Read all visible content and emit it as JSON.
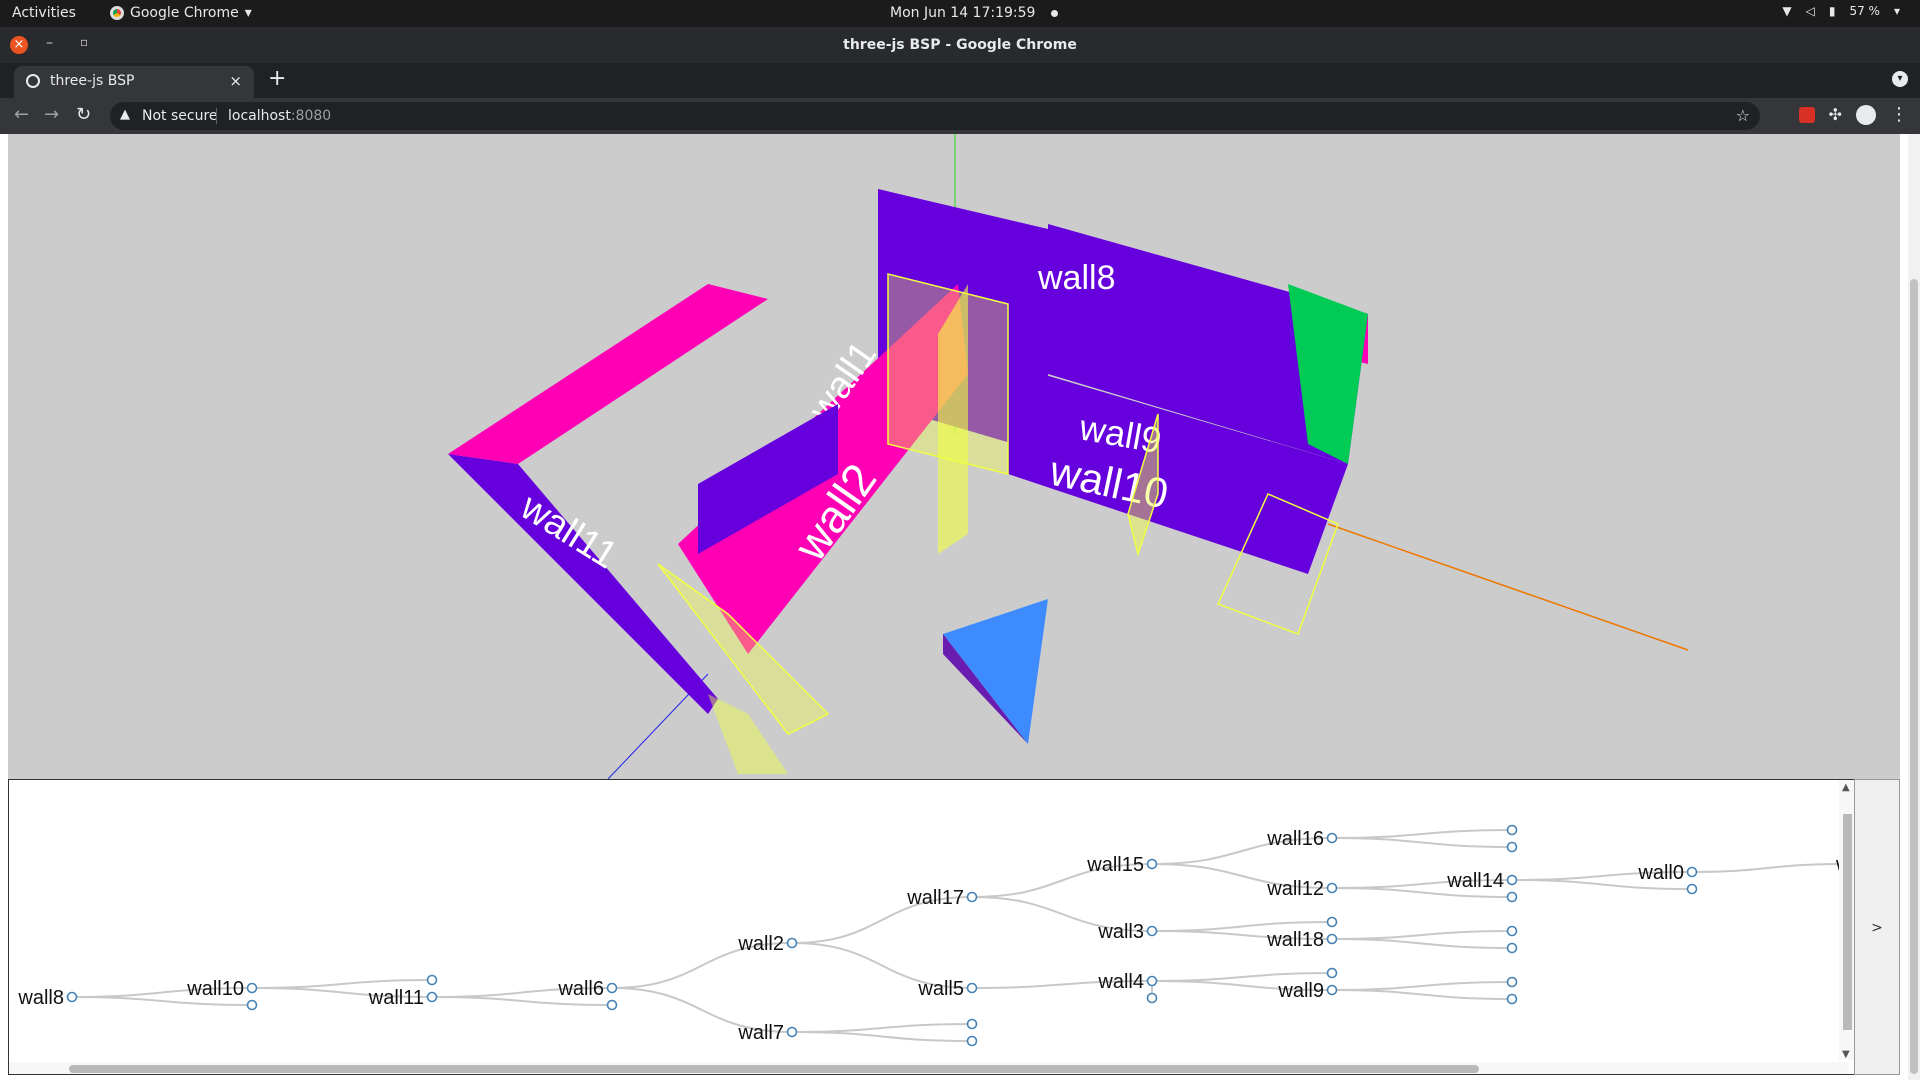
{
  "topbar": {
    "activities": "Activities",
    "app": "Google Chrome",
    "clock": "Mon Jun 14  17:19:59",
    "battery": "57 %"
  },
  "window": {
    "title": "three-js BSP - Google Chrome"
  },
  "tab": {
    "title": "three-js BSP"
  },
  "address": {
    "security": "Not secure",
    "host": "localhost",
    "port": ":8080"
  },
  "scene": {
    "wall_labels": [
      "wall8",
      "wall9",
      "wall10",
      "wall2",
      "wall11",
      "wall1"
    ],
    "colors": {
      "magenta": "#ff00b4",
      "purple": "#6600dd",
      "green": "#00cc55",
      "yellow": "#f0ff40",
      "background": "#cccccc"
    }
  },
  "tree": {
    "nodes": [
      {
        "id": "wall8",
        "label": "wall8"
      },
      {
        "id": "wall10",
        "label": "wall10"
      },
      {
        "id": "wall11",
        "label": "wall11"
      },
      {
        "id": "wall6",
        "label": "wall6"
      },
      {
        "id": "wall2",
        "label": "wall2"
      },
      {
        "id": "wall7",
        "label": "wall7"
      },
      {
        "id": "wall17",
        "label": "wall17"
      },
      {
        "id": "wall5",
        "label": "wall5"
      },
      {
        "id": "wall15",
        "label": "wall15"
      },
      {
        "id": "wall3",
        "label": "wall3"
      },
      {
        "id": "wall4",
        "label": "wall4"
      },
      {
        "id": "wall16",
        "label": "wall16"
      },
      {
        "id": "wall12",
        "label": "wall12"
      },
      {
        "id": "wall18",
        "label": "wall18"
      },
      {
        "id": "wall9",
        "label": "wall9"
      },
      {
        "id": "wall14",
        "label": "wall14"
      },
      {
        "id": "wall0",
        "label": "wall0"
      },
      {
        "id": "wa",
        "label": "wa"
      }
    ],
    "expand_label": ">"
  }
}
